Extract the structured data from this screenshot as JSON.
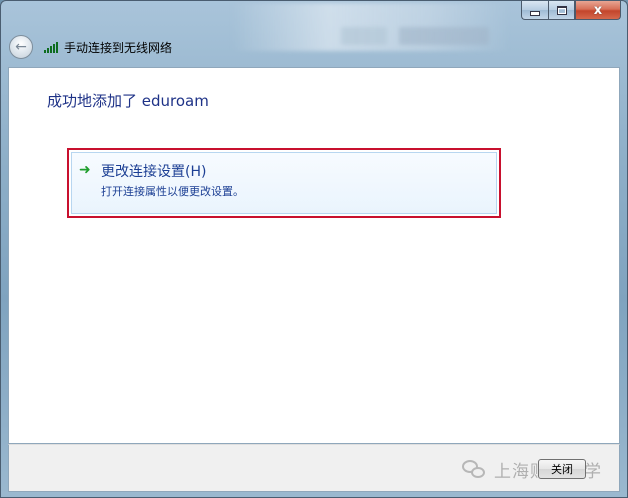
{
  "window": {
    "title": "手动连接到无线网络",
    "caption_buttons": {
      "minimize": "–",
      "maximize": "□",
      "close": "x"
    },
    "back_icon": "back-arrow-icon",
    "network_icon": "wifi-signal-icon"
  },
  "content": {
    "heading": "成功地添加了 eduroam",
    "option": {
      "icon": "green-arrow-icon",
      "title": "更改连接设置(H)",
      "description": "打开连接属性以便更改设置。"
    }
  },
  "footer": {
    "close_label": "关闭",
    "watermark": "上海财经大学"
  },
  "colors": {
    "heading": "#1e3287",
    "link": "#1c3f94",
    "highlight_border": "#c8102e",
    "arrow": "#1f9e2d"
  }
}
